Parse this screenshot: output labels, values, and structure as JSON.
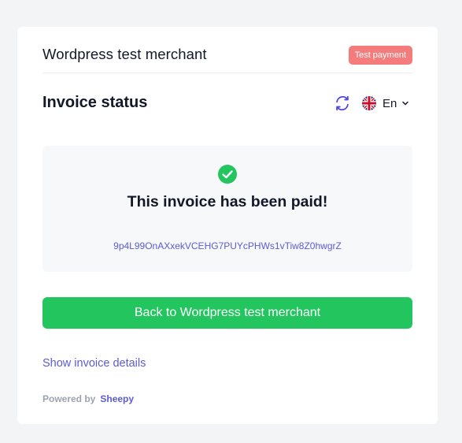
{
  "header": {
    "merchant_name": "Wordpress test merchant",
    "test_badge": "Test payment"
  },
  "status": {
    "title": "Invoice status",
    "language": "En",
    "icons": {
      "refresh": "refresh-icon",
      "flag": "uk-flag-icon",
      "chevron": "chevron-down-icon"
    }
  },
  "paid": {
    "message": "This invoice has been paid!",
    "invoice_id": "9p4L99OnAXxekVCEHG7PUYcPHWs1vTiw8Z0hwgrZ",
    "icon": "check-circle-icon"
  },
  "actions": {
    "back_label": "Back to Wordpress test merchant",
    "details_label": "Show invoice details"
  },
  "footer": {
    "powered_by": "Powered by",
    "brand": "Sheepy"
  },
  "colors": {
    "accent": "#5b5bd6",
    "success": "#22c55e",
    "badge": "#f47c7c"
  }
}
